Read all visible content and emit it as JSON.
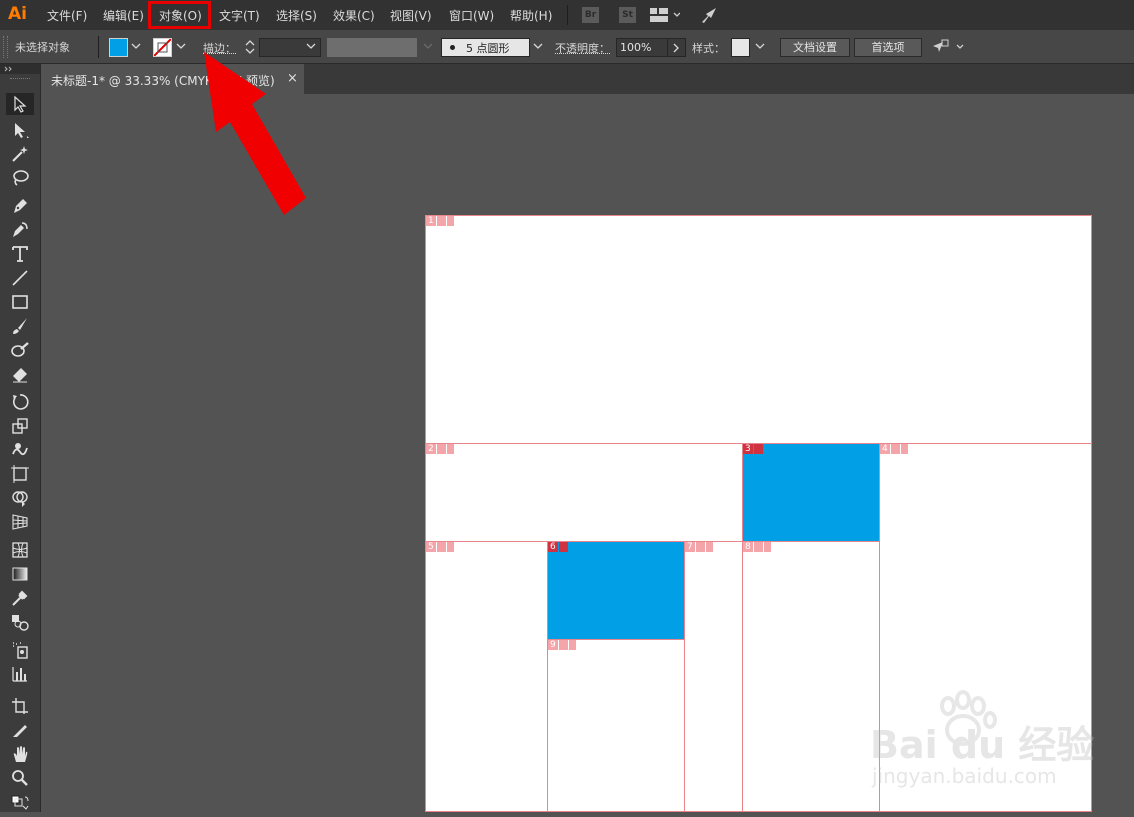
{
  "app": {
    "logo": "Ai"
  },
  "menu": {
    "items": [
      "文件(F)",
      "编辑(E)",
      "对象(O)",
      "文字(T)",
      "选择(S)",
      "效果(C)",
      "视图(V)",
      "窗口(W)",
      "帮助(H)"
    ],
    "highlighted": "对象(O)",
    "bridge_label": "Br",
    "stock_label": "St"
  },
  "control": {
    "selection_status": "未选择对象",
    "fill_color": "#009fe6",
    "stroke_label": "描边：",
    "brush_label": "5 点圆形",
    "opacity_label": "不透明度：",
    "opacity_value": "100%",
    "style_label": "样式：",
    "doc_setup_button": "文档设置",
    "preferences_button": "首选项"
  },
  "tab": {
    "title": "未标题-1* @ 33.33% (CMYK/GPU 预览)",
    "close": "×"
  },
  "artboards": [
    "1",
    "2",
    "3",
    "4",
    "5",
    "6",
    "7",
    "8",
    "9"
  ],
  "watermark": {
    "brand": "Bai du 经验",
    "url": "jingyan.baidu.com"
  },
  "colors": {
    "accent_red": "#e60000",
    "artboard_border": "#e8858a",
    "shape_blue": "#009fe6"
  }
}
